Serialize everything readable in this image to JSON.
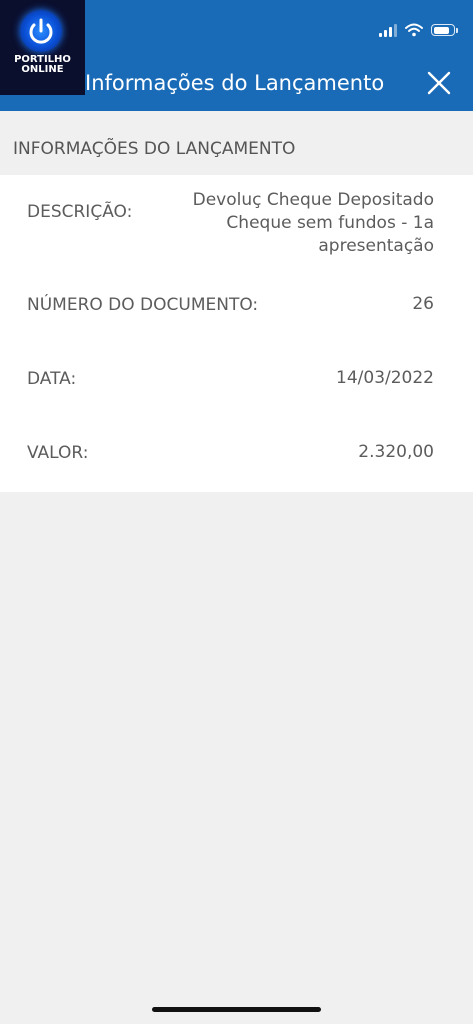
{
  "header": {
    "title": "Informações do Lançamento",
    "close_icon": "close-icon",
    "background_color": "#1a6bb7"
  },
  "logo": {
    "line1": "PORTILHO",
    "line2": "ONLINE",
    "icon": "power-icon"
  },
  "status_bar": {
    "icons": [
      "cellular-signal-icon",
      "wifi-icon",
      "battery-icon"
    ]
  },
  "section": {
    "heading": "INFORMAÇÕES DO LANÇAMENTO"
  },
  "details": {
    "descricao": {
      "label": "DESCRIÇÃO:",
      "line1": "Devoluç Cheque Depositado",
      "line2": "Cheque sem fundos - 1a",
      "line3": "apresentação"
    },
    "numero_documento": {
      "label": "NÚMERO DO DOCUMENTO:",
      "value": "26"
    },
    "data": {
      "label": "DATA:",
      "value": "14/03/2022"
    },
    "valor": {
      "label": "VALOR:",
      "value": "2.320,00"
    }
  }
}
